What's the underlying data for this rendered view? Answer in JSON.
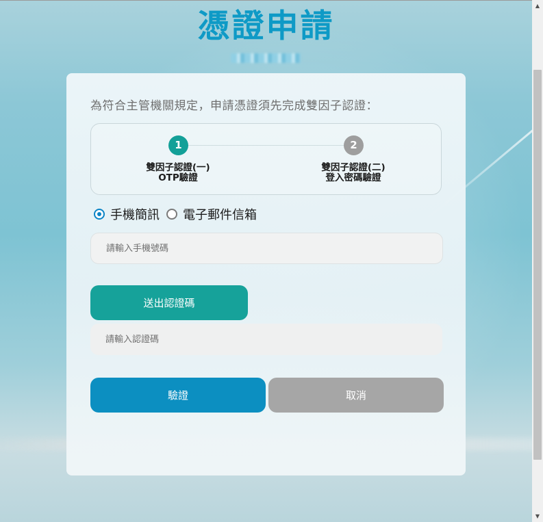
{
  "page": {
    "title": "憑證申請",
    "subtitle_redacted": "",
    "colors": {
      "title": "#0e9ac6",
      "step_active": "#13a098",
      "step_inactive": "#9e9e9e",
      "send_button": "#16a29a",
      "verify_button": "#0c8fc1",
      "cancel_button": "#a6a6a6",
      "radio_selected": "#0a84c6"
    }
  },
  "card": {
    "intro": "為符合主管機關規定，申請憑證須先完成雙因子認證："
  },
  "stepper": {
    "steps": [
      {
        "number": "1",
        "line1": "雙因子認證(一)",
        "line2": "OTP驗證",
        "state": "active"
      },
      {
        "number": "2",
        "line1": "雙因子認證(二)",
        "line2": "登入密碼驗證",
        "state": "inactive"
      }
    ]
  },
  "method": {
    "options": [
      {
        "label": "手機簡訊",
        "checked": true
      },
      {
        "label": "電子郵件信箱",
        "checked": false
      }
    ]
  },
  "form": {
    "phone_placeholder": "請輸入手機號碼",
    "phone_value": "",
    "code_placeholder": "請輸入認證碼",
    "code_value": "",
    "send_label": "送出認證碼",
    "verify_label": "驗證",
    "cancel_label": "取消"
  },
  "scrollbar": {
    "up_icon": "arrow-up-icon",
    "down_icon": "arrow-down-icon"
  }
}
